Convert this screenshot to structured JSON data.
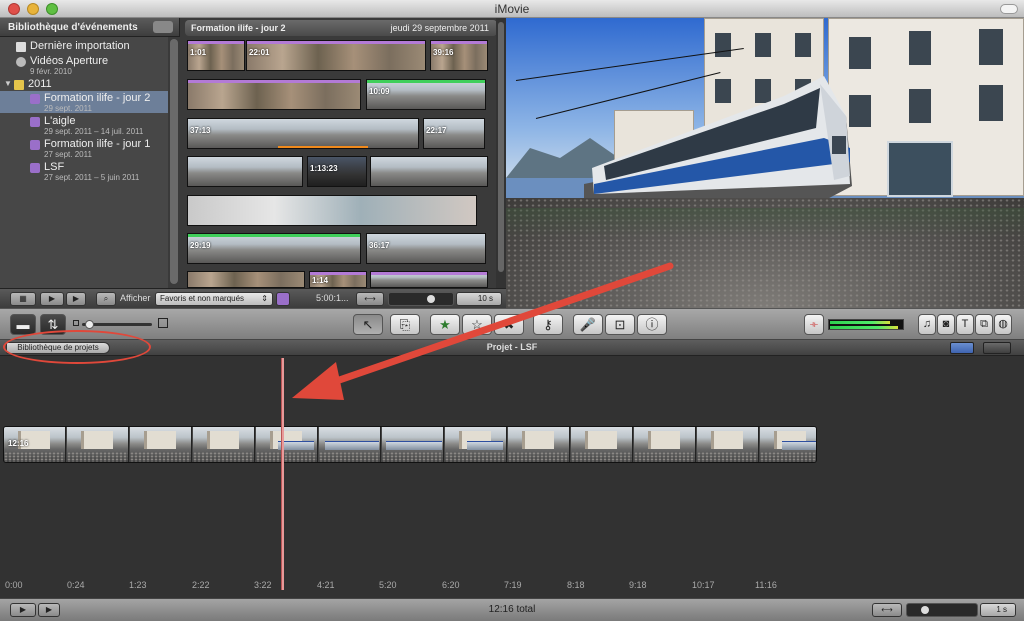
{
  "window": {
    "title": "iMovie"
  },
  "event_library": {
    "header": "Bibliothèque d'événements",
    "items": [
      {
        "label": "Dernière importation",
        "sub": ""
      },
      {
        "label": "Vidéos Aperture",
        "sub": "9 févr. 2010"
      },
      {
        "label": "2011",
        "sub": ""
      },
      {
        "label": "Formation ilife - jour 2",
        "sub": "29 sept. 2011"
      },
      {
        "label": "L'aigle",
        "sub": "29 sept. 2011 – 14 juil. 2011"
      },
      {
        "label": "Formation ilife - jour 1",
        "sub": "27 sept. 2011"
      },
      {
        "label": "LSF",
        "sub": "27 sept. 2011 – 5 juin 2011"
      }
    ]
  },
  "event_browser": {
    "title": "Formation ilife - jour 2",
    "date": "jeudi 29 septembre 2011",
    "clip_durations": [
      "1:01",
      "22:01",
      "39:16",
      "10:09",
      "37:13",
      "22:17",
      "1:13:23",
      "29:19",
      "36:17",
      "1:14"
    ]
  },
  "event_toolbar": {
    "show_label": "Afficher",
    "filter_value": "Favoris et non marqués",
    "duration": "5:00:1...",
    "zoom": "10 s"
  },
  "project": {
    "library_button": "Bibliothèque de projets",
    "title": "Projet - LSF",
    "clip_duration": "12:16",
    "ruler": [
      "0:00",
      "0:24",
      "1:23",
      "2:22",
      "3:22",
      "4:21",
      "5:20",
      "6:20",
      "7:19",
      "8:18",
      "9:18",
      "10:17",
      "11:16"
    ],
    "total": "12:16 total",
    "zoom": "1 s"
  },
  "colors": {
    "annotation": "#e0483a",
    "selection": "#6d7f99",
    "playhead": "#e89a9a"
  }
}
